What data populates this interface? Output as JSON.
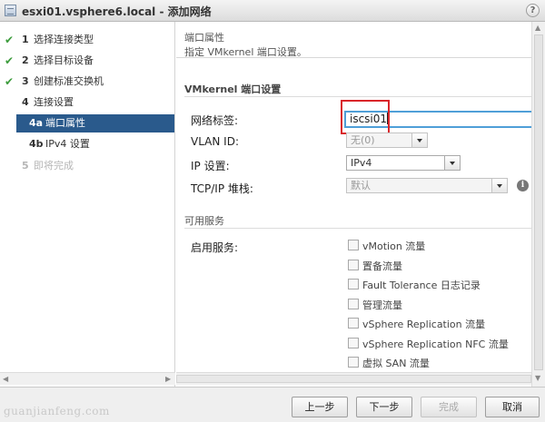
{
  "window": {
    "title": "esxi01.vsphere6.local - 添加网络",
    "help_glyph": "?"
  },
  "steps": [
    {
      "num": "1",
      "label": "选择连接类型",
      "done": true
    },
    {
      "num": "2",
      "label": "选择目标设备",
      "done": true
    },
    {
      "num": "3",
      "label": "创建标准交换机",
      "done": true
    },
    {
      "num": "4",
      "label": "连接设置",
      "done": false
    },
    {
      "num": "4a",
      "label": "端口属性",
      "active": true
    },
    {
      "num": "4b",
      "label": "IPv4 设置"
    },
    {
      "num": "5",
      "label": "即将完成",
      "disabled": true
    }
  ],
  "check_glyph": "✔",
  "header": {
    "title": "端口属性",
    "description": "指定 VMkernel 端口设置。"
  },
  "vmkernel": {
    "group_title": "VMkernel 端口设置",
    "network_label": {
      "label": "网络标签:",
      "value": "iscsi01"
    },
    "vlan_id": {
      "label": "VLAN ID:",
      "value": "无(0)"
    },
    "ip_setting": {
      "label": "IP 设置:",
      "value": "IPv4"
    },
    "tcpip_stack": {
      "label": "TCP/IP 堆栈:",
      "value": "默认"
    },
    "info_glyph": "i"
  },
  "services": {
    "group_title": "可用服务",
    "label": "启用服务:",
    "items": [
      "vMotion 流量",
      "置备流量",
      "Fault Tolerance 日志记录",
      "管理流量",
      "vSphere Replication 流量",
      "vSphere Replication NFC 流量",
      "虚拟 SAN 流量"
    ]
  },
  "footer": {
    "watermark": "guanjianfeng.com",
    "back": "上一步",
    "next": "下一步",
    "finish": "完成",
    "cancel": "取消"
  },
  "colors": {
    "active_step": "#2a5a8c",
    "check": "#3c9c3c",
    "highlight": "#d9252a",
    "focus": "#4f9fd8"
  }
}
